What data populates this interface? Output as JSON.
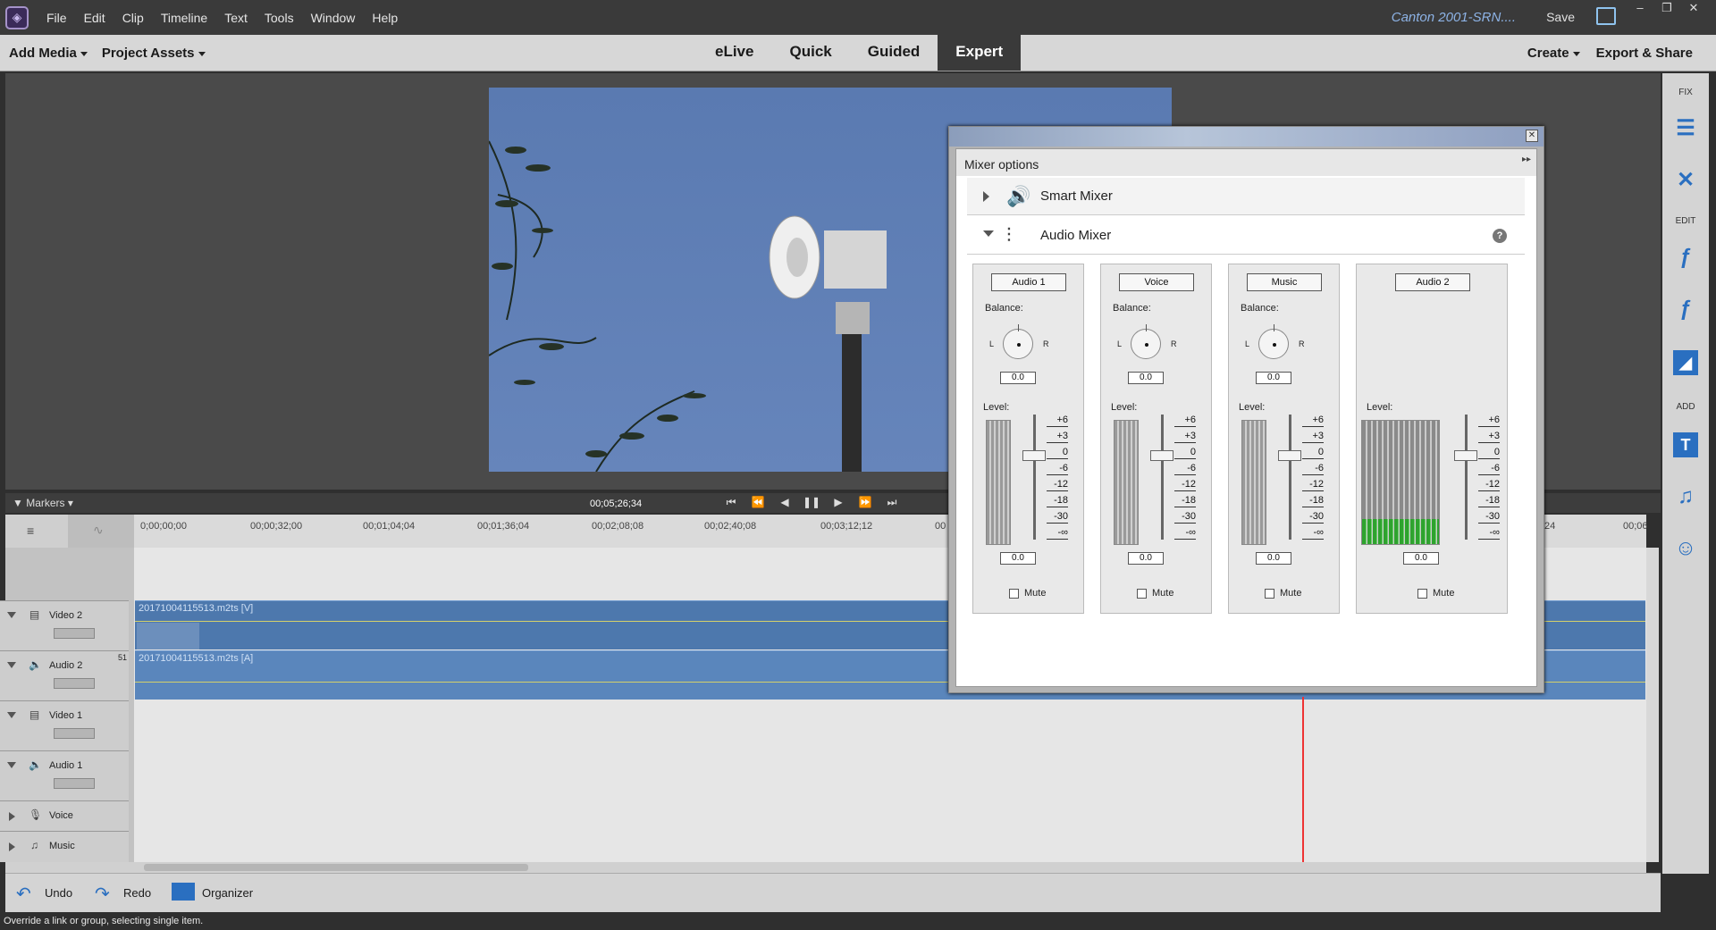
{
  "menu": [
    "File",
    "Edit",
    "Clip",
    "Timeline",
    "Text",
    "Tools",
    "Window",
    "Help"
  ],
  "project_name": "Canton 2001-SRN....",
  "save_label": "Save",
  "window_controls": [
    "–",
    "❐",
    "✕"
  ],
  "toolbar": {
    "add_media": "Add Media",
    "project_assets": "Project Assets",
    "create": "Create",
    "export_share": "Export & Share"
  },
  "modes": [
    "eLive",
    "Quick",
    "Guided",
    "Expert"
  ],
  "active_mode": "Expert",
  "timeline": {
    "markers_label": "Markers",
    "timecode": "00;05;26;34",
    "ruler_ticks": [
      "0;00;00;00",
      "00;00;32;00",
      "00;01;04;04",
      "00;01;36;04",
      "00;02;08;08",
      "00;02;40;08",
      "00;03;12;12",
      "00",
      "24",
      "00;06"
    ],
    "tracks": [
      {
        "name": "Video 2",
        "kind": "video"
      },
      {
        "name": "Audio 2",
        "kind": "audio"
      },
      {
        "name": "Video 1",
        "kind": "video"
      },
      {
        "name": "Audio 1",
        "kind": "audio"
      },
      {
        "name": "Voice",
        "kind": "voice"
      },
      {
        "name": "Music",
        "kind": "music"
      }
    ],
    "clip_video": "20171004115513.m2ts [V]",
    "clip_audio": "20171004115513.m2ts [A]",
    "track_badge": "51"
  },
  "mixer": {
    "title": "Mixer options",
    "smart_mixer": "Smart Mixer",
    "audio_mixer": "Audio Mixer",
    "help": "?",
    "balance_label": "Balance:",
    "level_label": "Level:",
    "mute_label": "Mute",
    "left": "L",
    "right": "R",
    "scale": [
      "+6",
      "+3",
      "0",
      "-6",
      "-12",
      "-18",
      "-30",
      "-∞"
    ],
    "channels": [
      {
        "name": "Audio 1",
        "balance": "0.0",
        "level": "0.0",
        "has_balance": true
      },
      {
        "name": "Voice",
        "balance": "0.0",
        "level": "0.0",
        "has_balance": true
      },
      {
        "name": "Music",
        "balance": "0.0",
        "level": "0.0",
        "has_balance": true
      },
      {
        "name": "Audio 2",
        "balance": "",
        "level": "0.0",
        "has_balance": false
      }
    ]
  },
  "right_panel": {
    "fix": "FIX",
    "edit": "EDIT",
    "add": "ADD"
  },
  "bottom": {
    "undo": "Undo",
    "redo": "Redo",
    "organizer": "Organizer"
  },
  "status": "Override a link or group, selecting single item."
}
